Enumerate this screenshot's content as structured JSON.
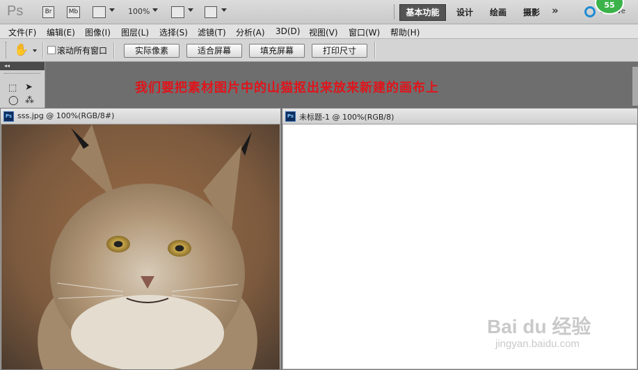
{
  "appbar": {
    "logo": "Ps",
    "bridge_icon": "Br",
    "minibridge_icon": "Mb",
    "zoom": "100%",
    "workspaces": {
      "active": "基本功能",
      "items": [
        "设计",
        "绘画",
        "摄影"
      ]
    },
    "cslive": "CS Live",
    "notification_count": "55"
  },
  "menu": {
    "items": [
      "文件(F)",
      "编辑(E)",
      "图像(I)",
      "图层(L)",
      "选择(S)",
      "滤镜(T)",
      "分析(A)",
      "3D(D)",
      "视图(V)",
      "窗口(W)",
      "帮助(H)"
    ]
  },
  "options": {
    "scroll_all_windows": "滚动所有窗口",
    "buttons": [
      "实际像素",
      "适合屏幕",
      "填充屏幕",
      "打印尺寸"
    ]
  },
  "caption": "我们要把素材图片中的山猫抠出来放来新建的画布上",
  "documents": {
    "source": {
      "title": "sss.jpg @ 100%(RGB/8#)"
    },
    "target": {
      "title": "未标题-1 @ 100%(RGB/8)"
    }
  },
  "watermark": {
    "brand": "Bai du 经验",
    "url": "jingyan.baidu.com"
  }
}
